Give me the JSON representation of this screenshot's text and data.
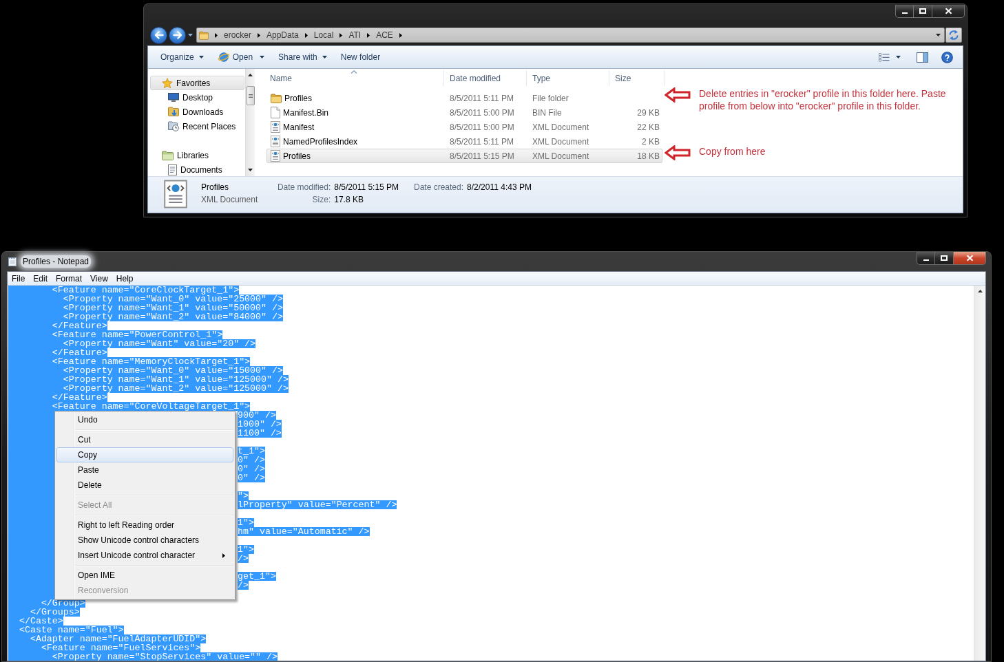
{
  "explorer": {
    "active": false,
    "address_bar": {
      "path": [
        "erocker",
        "AppData",
        "Local",
        "ATI",
        "ACE"
      ]
    },
    "toolbar": [
      {
        "label": "Organize",
        "kind": "menu"
      },
      {
        "label": "Open",
        "kind": "open"
      },
      {
        "label": "Share with",
        "kind": "menu"
      },
      {
        "label": "New folder",
        "kind": "plain"
      }
    ],
    "navigation": [
      {
        "label": "Favorites",
        "kind": "favorites",
        "selected": true,
        "children": [
          {
            "label": "Desktop",
            "kind": "desktop",
            "selected": false
          },
          {
            "label": "Downloads",
            "kind": "downloads",
            "selected": false
          },
          {
            "label": "Recent Places",
            "kind": "recent",
            "selected": false
          }
        ]
      },
      {
        "label": "Libraries",
        "kind": "libraries",
        "selected": false,
        "children": [
          {
            "label": "Documents",
            "kind": "documents",
            "selected": false
          }
        ]
      }
    ],
    "file_list": {
      "columns": [
        {
          "label": "Name",
          "sorted": true
        },
        {
          "label": "Date modified",
          "sorted": false
        },
        {
          "label": "Type",
          "sorted": false
        },
        {
          "label": "Size",
          "sorted": false
        }
      ],
      "rows": [
        {
          "name": "Profiles",
          "kind": "folder",
          "date_modified": "8/5/2011 5:11 PM",
          "type": "File folder",
          "selected": false,
          "annotation": "Delete entries in \"erocker\" profile in this folder here. Paste profile from below into \"erocker\" profile in this folder."
        },
        {
          "name": "Manifest.Bin",
          "kind": "file",
          "date_modified": "8/5/2011 5:00 PM",
          "type": "BIN File",
          "size": "29 KB",
          "selected": false
        },
        {
          "name": "Manifest",
          "kind": "xml",
          "date_modified": "8/5/2011 5:00 PM",
          "type": "XML Document",
          "size": "22 KB",
          "selected": false
        },
        {
          "name": "NamedProfilesIndex",
          "kind": "xml",
          "date_modified": "8/5/2011 5:11 PM",
          "type": "XML Document",
          "size": "2 KB",
          "selected": false
        },
        {
          "name": "Profiles",
          "kind": "xml",
          "date_modified": "8/5/2011 5:15 PM",
          "type": "XML Document",
          "size": "18 KB",
          "selected": true,
          "annotation": "Copy from here"
        }
      ]
    },
    "details_pane": {
      "name": "Profiles",
      "type": "XML Document",
      "property_columns": [
        [
          {
            "label": "Date modified:",
            "value": "8/5/2011 5:15 PM"
          },
          {
            "label": "Size:",
            "value": "17.8 KB"
          }
        ],
        [
          {
            "label": "Date created:",
            "value": "8/2/2011 4:43 PM"
          }
        ]
      ]
    }
  },
  "notepad": {
    "active": true,
    "title": "Profiles - Notepad",
    "menu": [
      "File",
      "Edit",
      "Format",
      "View",
      "Help"
    ],
    "text_selected": true,
    "lines": [
      {
        "kind": "full",
        "text": "        <Feature name=\"CoreClockTarget_1\">"
      },
      {
        "kind": "full",
        "text": "          <Property name=\"Want_0\" value=\"25000\" />"
      },
      {
        "kind": "full",
        "text": "          <Property name=\"Want_1\" value=\"50000\" />"
      },
      {
        "kind": "full",
        "text": "          <Property name=\"Want_2\" value=\"84000\" />"
      },
      {
        "kind": "full",
        "text": "        </Feature>"
      },
      {
        "kind": "full",
        "text": "        <Feature name=\"PowerControl_1\">"
      },
      {
        "kind": "full",
        "text": "          <Property name=\"Want\" value=\"20\" />"
      },
      {
        "kind": "full",
        "text": "        </Feature>"
      },
      {
        "kind": "full",
        "text": "        <Feature name=\"MemoryClockTarget_1\">"
      },
      {
        "kind": "full",
        "text": "          <Property name=\"Want_0\" value=\"15000\" />"
      },
      {
        "kind": "full",
        "text": "          <Property name=\"Want_1\" value=\"125000\" />"
      },
      {
        "kind": "full",
        "text": "          <Property name=\"Want_2\" value=\"125000\" />"
      },
      {
        "kind": "full",
        "text": "        </Feature>"
      },
      {
        "kind": "full",
        "text": "        <Feature name=\"CoreVoltageTarget_1\">"
      },
      {
        "kind": "covered",
        "text": "900\" />"
      },
      {
        "kind": "covered",
        "text": "1000\" />"
      },
      {
        "kind": "covered",
        "text": "1100\" />"
      },
      {
        "kind": "hidden"
      },
      {
        "kind": "covered",
        "text": "t_1\">"
      },
      {
        "kind": "covered",
        "text": "0\" />"
      },
      {
        "kind": "covered",
        "text": "0\" />"
      },
      {
        "kind": "covered",
        "text": "0\" />"
      },
      {
        "kind": "hidden"
      },
      {
        "kind": "covered",
        "text": "\">"
      },
      {
        "kind": "covered",
        "text": "lProperty\" value=\"Percent\" />"
      },
      {
        "kind": "hidden"
      },
      {
        "kind": "covered",
        "text": "1\">"
      },
      {
        "kind": "covered",
        "text": "hm\" value=\"Automatic\" />"
      },
      {
        "kind": "hidden"
      },
      {
        "kind": "covered",
        "text": "1\">"
      },
      {
        "kind": "covered",
        "text": "/>"
      },
      {
        "kind": "hidden"
      },
      {
        "kind": "covered",
        "text": "get_1\">"
      },
      {
        "kind": "covered",
        "text": "/>"
      },
      {
        "kind": "hidden"
      },
      {
        "kind": "full",
        "text": "      </Group>"
      },
      {
        "kind": "full",
        "text": "    </Groups>"
      },
      {
        "kind": "full",
        "text": "  </Caste>"
      },
      {
        "kind": "full",
        "text": "  <Caste name=\"Fuel\">"
      },
      {
        "kind": "full",
        "text": "    <Adapter name=\"FuelAdapterUDID\">"
      },
      {
        "kind": "full",
        "text": "      <Feature name=\"FuelServices\">"
      },
      {
        "kind": "full",
        "text": "        <Property name=\"StopServices\" value=\"\" />"
      }
    ],
    "context_menu": {
      "groups": [
        [
          {
            "label": "Undo",
            "disabled": false,
            "selected": false,
            "submenu": false
          }
        ],
        [
          {
            "label": "Cut",
            "disabled": false,
            "selected": false,
            "submenu": false
          },
          {
            "label": "Copy",
            "disabled": false,
            "selected": true,
            "submenu": false
          },
          {
            "label": "Paste",
            "disabled": false,
            "selected": false,
            "submenu": false
          },
          {
            "label": "Delete",
            "disabled": false,
            "selected": false,
            "submenu": false
          }
        ],
        [
          {
            "label": "Select All",
            "disabled": true,
            "selected": false,
            "submenu": false
          }
        ],
        [
          {
            "label": "Right to left Reading order",
            "disabled": false,
            "selected": false,
            "submenu": false
          },
          {
            "label": "Show Unicode control characters",
            "disabled": false,
            "selected": false,
            "submenu": false
          },
          {
            "label": "Insert Unicode control character",
            "disabled": false,
            "selected": false,
            "submenu": true
          }
        ],
        [
          {
            "label": "Open IME",
            "disabled": false,
            "selected": false,
            "submenu": false
          },
          {
            "label": "Reconversion",
            "disabled": true,
            "selected": false,
            "submenu": false
          }
        ]
      ]
    }
  }
}
